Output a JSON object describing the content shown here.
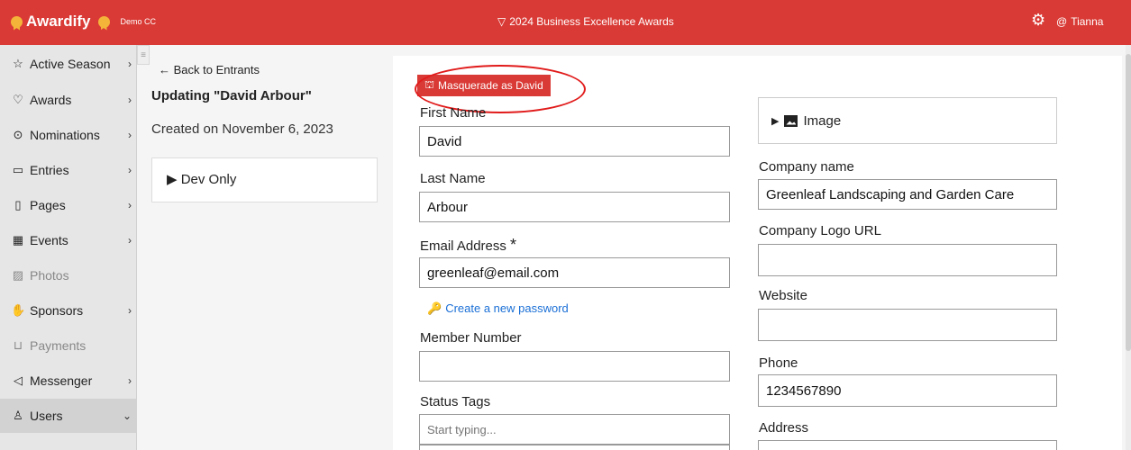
{
  "topbar": {
    "brand": "Awardify",
    "tenant": "Demo CC",
    "season_icon": "▽",
    "season": "2024 Business Excellence Awards",
    "gear_icon": "⚙",
    "user_icon": "@",
    "user": "Tianna",
    "bar_color": "#d93a35",
    "accent_color": "#f4b43a"
  },
  "sidebar": {
    "items": [
      {
        "icon": "☆",
        "label": "Active Season",
        "chevron": "›"
      },
      {
        "icon": "♡",
        "label": "Awards",
        "chevron": "›"
      },
      {
        "icon": "⊙",
        "label": "Nominations",
        "chevron": "›"
      },
      {
        "icon": "▭",
        "label": "Entries",
        "chevron": "›"
      },
      {
        "icon": "▯",
        "label": "Pages",
        "chevron": "›"
      },
      {
        "icon": "▦",
        "label": "Events",
        "chevron": "›"
      },
      {
        "icon": "▨",
        "label": "Photos",
        "chevron": ""
      },
      {
        "icon": "✋",
        "label": "Sponsors",
        "chevron": "›"
      },
      {
        "icon": "⊔",
        "label": "Payments",
        "chevron": ""
      },
      {
        "icon": "◁",
        "label": "Messenger",
        "chevron": "›"
      },
      {
        "icon": "♙",
        "label": "Users",
        "chevron": "⌄"
      }
    ],
    "collapse_icon": "≡"
  },
  "info": {
    "back_label": "← Back to Entrants",
    "title": "Updating \"David Arbour\"",
    "created": "Created on November 6, 2023",
    "dev_only": "▶ Dev Only"
  },
  "form": {
    "masquerade_icon": "⛫",
    "masquerade_label": "Masquerade as David",
    "first_name_label": "First Name",
    "first_name": "David",
    "last_name_label": "Last Name",
    "last_name": "Arbour",
    "email_label": "Email Address",
    "email_required": "*",
    "email": "greenleaf@email.com",
    "password_icon": "🔑",
    "password_link": "Create a new password",
    "member_label": "Member Number",
    "member": "",
    "status_label": "Status Tags",
    "status_placeholder": "Start typing...",
    "image_label": "Image",
    "image_caret": "▶",
    "company_label": "Company name",
    "company": "Greenleaf Landscaping and Garden Care",
    "logo_label": "Company Logo URL",
    "logo": "",
    "website_label": "Website",
    "website": "",
    "phone_label": "Phone",
    "phone": "1234567890",
    "address_label": "Address",
    "address": ""
  }
}
